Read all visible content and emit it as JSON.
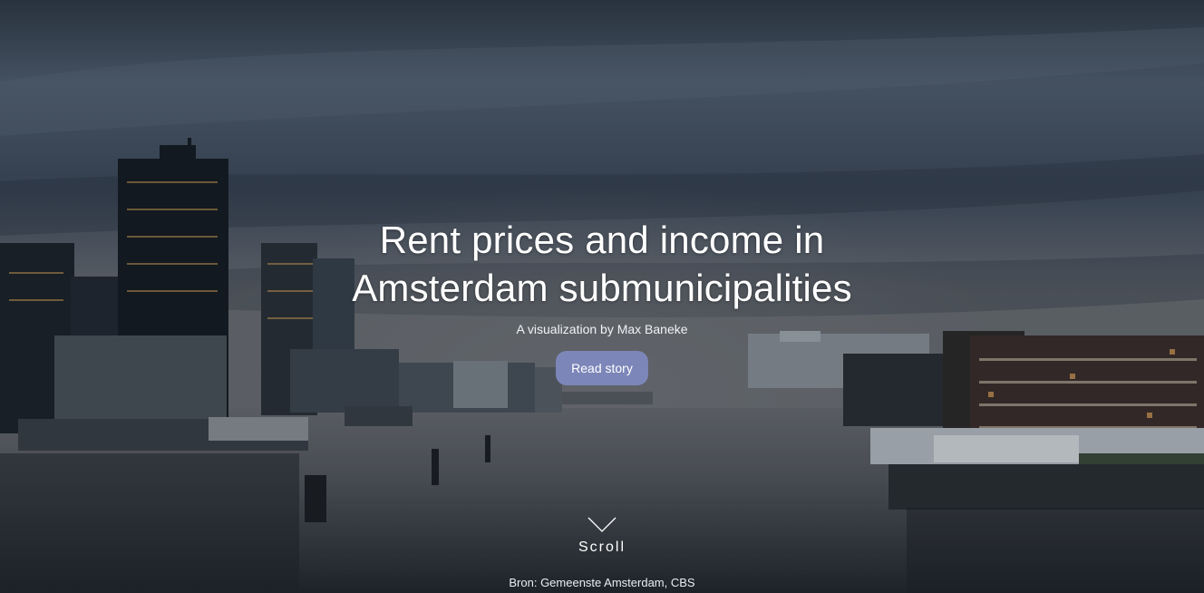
{
  "hero": {
    "title_line1": "Rent prices and income in",
    "title_line2": "Amsterdam submunicipalities",
    "subtitle": "A visualization by Max Baneke",
    "cta_label": "Read story",
    "scroll_label": "Scroll",
    "source": "Bron: Gemeenste Amsterdam, CBS"
  },
  "colors": {
    "cta_background": "#7c86b8",
    "text": "#ffffff"
  },
  "icons": {
    "scroll": "chevron-down-icon",
    "background": "amsterdam-skyline-photo"
  }
}
